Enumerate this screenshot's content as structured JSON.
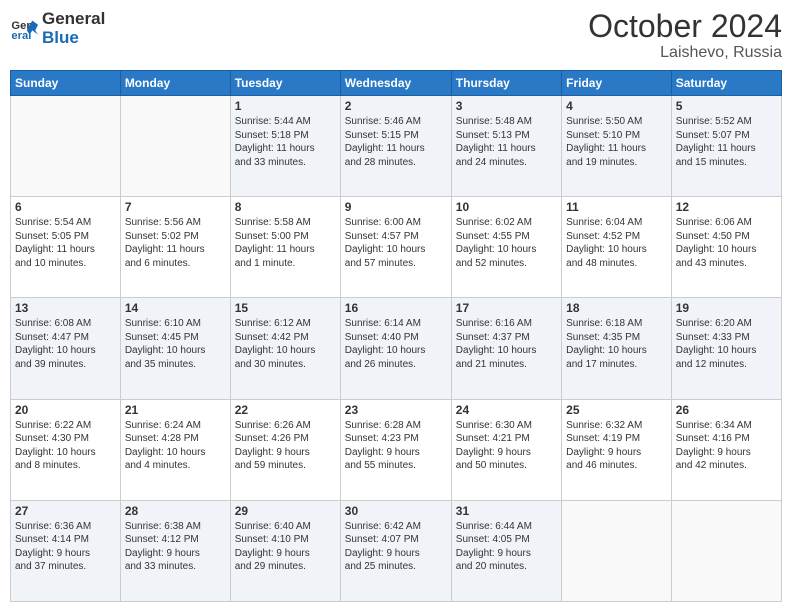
{
  "logo": {
    "line1": "General",
    "line2": "Blue"
  },
  "title": "October 2024",
  "location": "Laishevo, Russia",
  "days_header": [
    "Sunday",
    "Monday",
    "Tuesday",
    "Wednesday",
    "Thursday",
    "Friday",
    "Saturday"
  ],
  "weeks": [
    [
      {
        "num": "",
        "info": ""
      },
      {
        "num": "",
        "info": ""
      },
      {
        "num": "1",
        "info": "Sunrise: 5:44 AM\nSunset: 5:18 PM\nDaylight: 11 hours\nand 33 minutes."
      },
      {
        "num": "2",
        "info": "Sunrise: 5:46 AM\nSunset: 5:15 PM\nDaylight: 11 hours\nand 28 minutes."
      },
      {
        "num": "3",
        "info": "Sunrise: 5:48 AM\nSunset: 5:13 PM\nDaylight: 11 hours\nand 24 minutes."
      },
      {
        "num": "4",
        "info": "Sunrise: 5:50 AM\nSunset: 5:10 PM\nDaylight: 11 hours\nand 19 minutes."
      },
      {
        "num": "5",
        "info": "Sunrise: 5:52 AM\nSunset: 5:07 PM\nDaylight: 11 hours\nand 15 minutes."
      }
    ],
    [
      {
        "num": "6",
        "info": "Sunrise: 5:54 AM\nSunset: 5:05 PM\nDaylight: 11 hours\nand 10 minutes."
      },
      {
        "num": "7",
        "info": "Sunrise: 5:56 AM\nSunset: 5:02 PM\nDaylight: 11 hours\nand 6 minutes."
      },
      {
        "num": "8",
        "info": "Sunrise: 5:58 AM\nSunset: 5:00 PM\nDaylight: 11 hours\nand 1 minute."
      },
      {
        "num": "9",
        "info": "Sunrise: 6:00 AM\nSunset: 4:57 PM\nDaylight: 10 hours\nand 57 minutes."
      },
      {
        "num": "10",
        "info": "Sunrise: 6:02 AM\nSunset: 4:55 PM\nDaylight: 10 hours\nand 52 minutes."
      },
      {
        "num": "11",
        "info": "Sunrise: 6:04 AM\nSunset: 4:52 PM\nDaylight: 10 hours\nand 48 minutes."
      },
      {
        "num": "12",
        "info": "Sunrise: 6:06 AM\nSunset: 4:50 PM\nDaylight: 10 hours\nand 43 minutes."
      }
    ],
    [
      {
        "num": "13",
        "info": "Sunrise: 6:08 AM\nSunset: 4:47 PM\nDaylight: 10 hours\nand 39 minutes."
      },
      {
        "num": "14",
        "info": "Sunrise: 6:10 AM\nSunset: 4:45 PM\nDaylight: 10 hours\nand 35 minutes."
      },
      {
        "num": "15",
        "info": "Sunrise: 6:12 AM\nSunset: 4:42 PM\nDaylight: 10 hours\nand 30 minutes."
      },
      {
        "num": "16",
        "info": "Sunrise: 6:14 AM\nSunset: 4:40 PM\nDaylight: 10 hours\nand 26 minutes."
      },
      {
        "num": "17",
        "info": "Sunrise: 6:16 AM\nSunset: 4:37 PM\nDaylight: 10 hours\nand 21 minutes."
      },
      {
        "num": "18",
        "info": "Sunrise: 6:18 AM\nSunset: 4:35 PM\nDaylight: 10 hours\nand 17 minutes."
      },
      {
        "num": "19",
        "info": "Sunrise: 6:20 AM\nSunset: 4:33 PM\nDaylight: 10 hours\nand 12 minutes."
      }
    ],
    [
      {
        "num": "20",
        "info": "Sunrise: 6:22 AM\nSunset: 4:30 PM\nDaylight: 10 hours\nand 8 minutes."
      },
      {
        "num": "21",
        "info": "Sunrise: 6:24 AM\nSunset: 4:28 PM\nDaylight: 10 hours\nand 4 minutes."
      },
      {
        "num": "22",
        "info": "Sunrise: 6:26 AM\nSunset: 4:26 PM\nDaylight: 9 hours\nand 59 minutes."
      },
      {
        "num": "23",
        "info": "Sunrise: 6:28 AM\nSunset: 4:23 PM\nDaylight: 9 hours\nand 55 minutes."
      },
      {
        "num": "24",
        "info": "Sunrise: 6:30 AM\nSunset: 4:21 PM\nDaylight: 9 hours\nand 50 minutes."
      },
      {
        "num": "25",
        "info": "Sunrise: 6:32 AM\nSunset: 4:19 PM\nDaylight: 9 hours\nand 46 minutes."
      },
      {
        "num": "26",
        "info": "Sunrise: 6:34 AM\nSunset: 4:16 PM\nDaylight: 9 hours\nand 42 minutes."
      }
    ],
    [
      {
        "num": "27",
        "info": "Sunrise: 6:36 AM\nSunset: 4:14 PM\nDaylight: 9 hours\nand 37 minutes."
      },
      {
        "num": "28",
        "info": "Sunrise: 6:38 AM\nSunset: 4:12 PM\nDaylight: 9 hours\nand 33 minutes."
      },
      {
        "num": "29",
        "info": "Sunrise: 6:40 AM\nSunset: 4:10 PM\nDaylight: 9 hours\nand 29 minutes."
      },
      {
        "num": "30",
        "info": "Sunrise: 6:42 AM\nSunset: 4:07 PM\nDaylight: 9 hours\nand 25 minutes."
      },
      {
        "num": "31",
        "info": "Sunrise: 6:44 AM\nSunset: 4:05 PM\nDaylight: 9 hours\nand 20 minutes."
      },
      {
        "num": "",
        "info": ""
      },
      {
        "num": "",
        "info": ""
      }
    ]
  ]
}
